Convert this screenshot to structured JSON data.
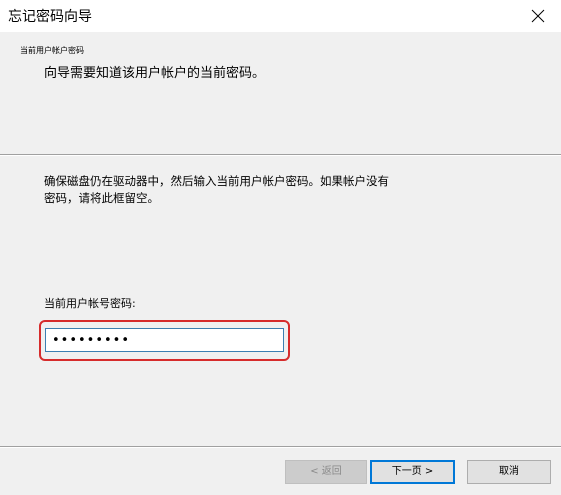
{
  "window": {
    "title": "忘记密码向导"
  },
  "icons": {
    "close": "close-icon"
  },
  "header": {
    "title": "当前用户帐户密码",
    "subtitle": "向导需要知道该用户帐户的当前密码。"
  },
  "body": {
    "instruction_line1": "确保磁盘仍在驱动器中，然后输入当前用户帐户密码。如果帐户没有",
    "instruction_line2": "密码，请将此框留空。",
    "password_label": "当前用户帐号密码:",
    "password_value": "•••••••••",
    "highlight_color": "#d62b2b"
  },
  "buttons": {
    "back": "< 返回",
    "next": "下一页 >",
    "cancel": "取消"
  }
}
